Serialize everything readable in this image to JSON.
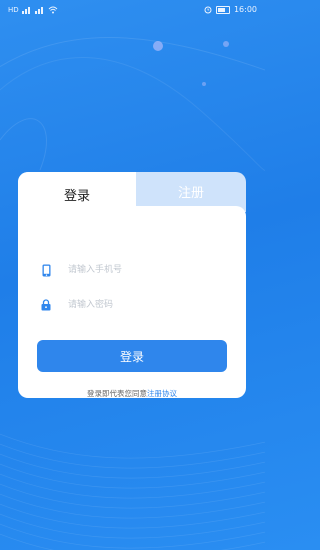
{
  "status_bar": {
    "left_text": "HD",
    "time": "16:00",
    "icons": [
      "signal-icon",
      "signal-icon",
      "wifi-icon",
      "alarm-icon",
      "battery-icon"
    ]
  },
  "tabs": [
    {
      "label": "登录",
      "active": true
    },
    {
      "label": "注册",
      "active": false
    }
  ],
  "form": {
    "phone_placeholder": "请输入手机号",
    "password_placeholder": "请输入密码",
    "login_button": "登录"
  },
  "agreement": {
    "prefix": "登录即代表您同意",
    "link": "注册协议"
  },
  "colors": {
    "primary": "#2f86ec",
    "tab_inactive": "#cfe3fb",
    "background": "#2585ec"
  }
}
